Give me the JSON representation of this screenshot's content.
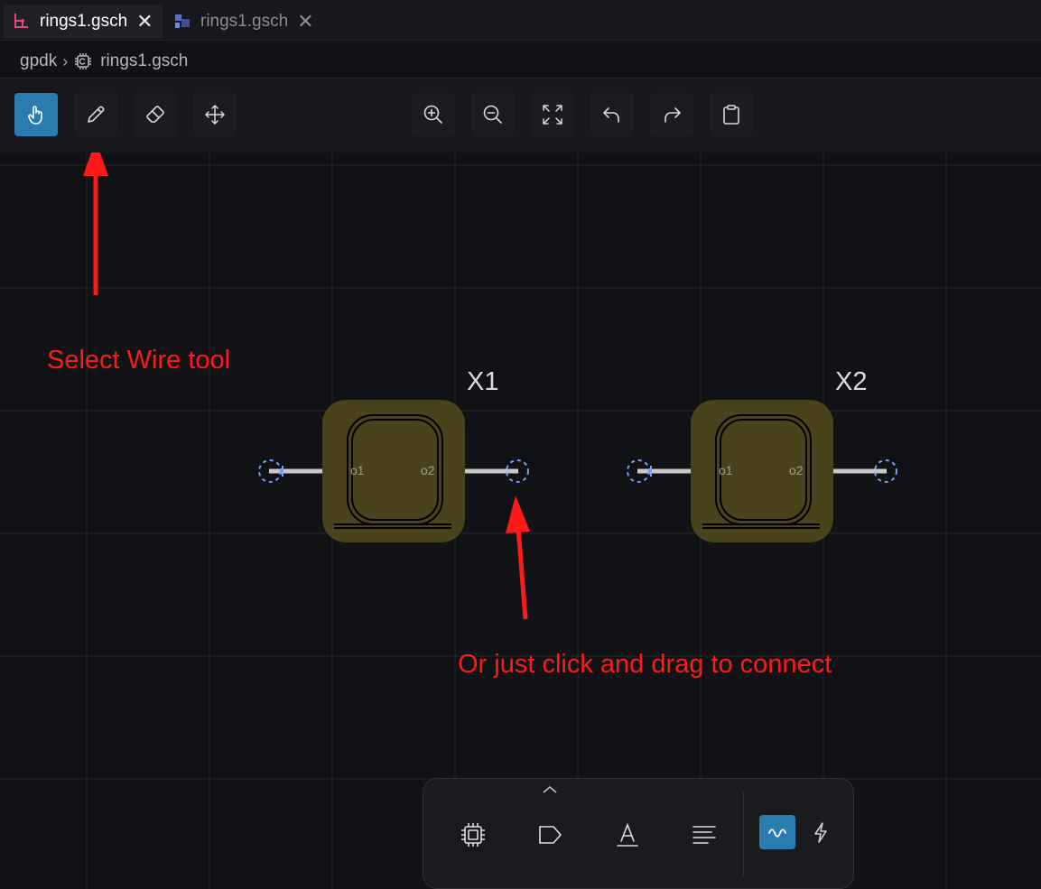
{
  "tabs": [
    {
      "label": "rings1.gsch",
      "active": true,
      "icon": "schematic-icon",
      "close": "✕"
    },
    {
      "label": "rings1.gsch",
      "active": false,
      "icon": "layout-icon",
      "close": "✕"
    }
  ],
  "breadcrumb": {
    "root": "gpdk",
    "separator": "›",
    "file": "rings1.gsch",
    "file_icon": "chip-icon"
  },
  "toolbar": {
    "left_tools": [
      "select-tool",
      "wire-tool",
      "eraser-tool",
      "move-tool"
    ],
    "active_tool": "select-tool",
    "center_tools": [
      "zoom-in",
      "zoom-out",
      "fit-view",
      "undo",
      "redo",
      "clipboard"
    ]
  },
  "components": [
    {
      "name": "X1",
      "ports": [
        "o1",
        "o2"
      ]
    },
    {
      "name": "X2",
      "ports": [
        "o1",
        "o2"
      ]
    }
  ],
  "annotations": {
    "wire_tool_hint": "Select Wire tool",
    "drag_hint": "Or just click and drag to connect"
  },
  "bottom_panel": {
    "items": [
      "chip-icon",
      "tag-icon",
      "text-icon",
      "align-icon"
    ],
    "mode_buttons": [
      "wave-icon",
      "lightning-icon"
    ],
    "active_mode": "wave-icon"
  },
  "colors": {
    "accent": "#2a7bb0",
    "annotation": "#ff1a1a",
    "component_fill": "#4a421a",
    "background": "#111216"
  }
}
